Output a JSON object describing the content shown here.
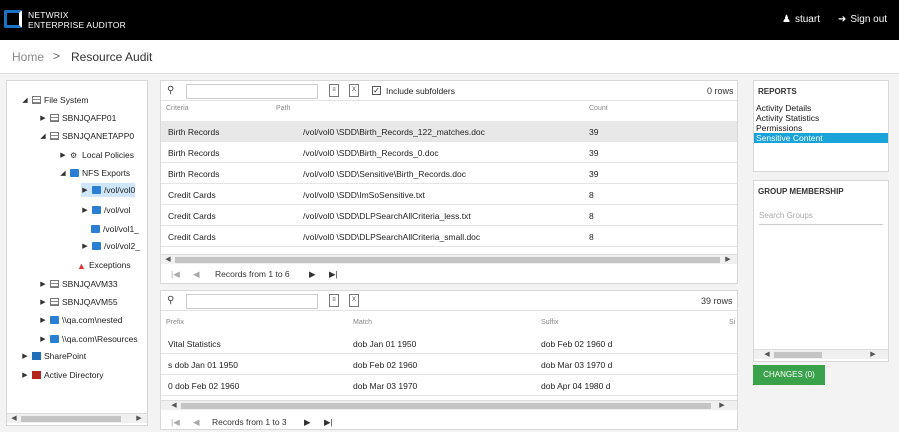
{
  "header": {
    "brand_line1": "NETWRIX",
    "brand_line2": "ENTERPRISE AUDITOR",
    "user_name": "stuart",
    "signout_label": "Sign out"
  },
  "breadcrumb": {
    "home": "Home",
    "separator": ">",
    "current": "Resource Audit"
  },
  "tree": {
    "nodes": [
      {
        "label": "File System",
        "icon": "file-system-icon"
      },
      {
        "label": "SBNJQAFP01",
        "icon": "server-icon"
      },
      {
        "label": "SBNJQANETAPP0",
        "icon": "server-icon"
      },
      {
        "label": "Local Policies",
        "icon": "policy-icon"
      },
      {
        "label": "NFS Exports",
        "icon": "folder-icon"
      },
      {
        "label": "/vol/vol0",
        "icon": "folder-icon"
      },
      {
        "label": "/vol/vol",
        "icon": "folder-lock-icon"
      },
      {
        "label": "/vol/vol1_",
        "icon": "folder-icon"
      },
      {
        "label": "/vol/vol2_",
        "icon": "folder-icon"
      },
      {
        "label": "Exceptions",
        "icon": "warning-icon"
      },
      {
        "label": "SBNJQAVM33",
        "icon": "server-icon"
      },
      {
        "label": "SBNJQAVM55",
        "icon": "server-icon"
      },
      {
        "label": "\\\\qa.com\\nested",
        "icon": "folder-icon"
      },
      {
        "label": "\\\\qa.com\\Resources",
        "icon": "folder-icon"
      },
      {
        "label": "SharePoint",
        "icon": "sharepoint-icon"
      },
      {
        "label": "Active Directory",
        "icon": "active-directory-icon"
      }
    ]
  },
  "grid1": {
    "include_subfolders_label": "Include subfolders",
    "include_subfolders_checked": true,
    "row_count": "0 rows",
    "columns": [
      "Criteria",
      "Path",
      "Count"
    ],
    "rows": [
      {
        "criteria": "Birth Records",
        "path": "/vol/vol0 \\SDD\\Birth_Records_122_matches.doc",
        "count": "39"
      },
      {
        "criteria": "Birth Records",
        "path": "/vol/vol0 \\SDD\\Birth_Records_0.doc",
        "count": "39"
      },
      {
        "criteria": "Birth Records",
        "path": "/vol/vol0 \\SDD\\Sensitive\\Birth_Records.doc",
        "count": "39"
      },
      {
        "criteria": "Credit Cards",
        "path": "/vol/vol0 \\SDD\\ImSoSensitive.txt",
        "count": "8"
      },
      {
        "criteria": "Credit Cards",
        "path": "/vol/vol0 \\SDD\\DLPSearchAllCriteria_less.txt",
        "count": "8"
      },
      {
        "criteria": "Credit Cards",
        "path": "/vol/vol0 \\SDD\\DLPSearchAllCriteria_small.doc",
        "count": "8"
      }
    ],
    "pager_text": "Records from 1 to 6"
  },
  "grid2": {
    "row_count": "39 rows",
    "columns": [
      "Prefix",
      "Match",
      "Suffix",
      "Si"
    ],
    "rows": [
      {
        "prefix": "Vital Statistics",
        "match": "dob Jan 01 1950",
        "suffix": "dob Feb 02 1960 d"
      },
      {
        "prefix": "s dob Jan 01 1950",
        "match": "dob Feb 02 1960",
        "suffix": "dob Mar 03 1970 d"
      },
      {
        "prefix": "0 dob Feb 02 1960",
        "match": "dob Mar 03 1970",
        "suffix": "dob Apr 04 1980 d"
      }
    ],
    "pager_text": "Records from 1 to 3"
  },
  "reports": {
    "title": "REPORTS",
    "items": [
      "Activity Details",
      "Activity Statistics",
      "Permissions",
      "Sensitive Content"
    ],
    "active_index": 3
  },
  "group_membership": {
    "title": "GROUP MEMBERSHIP",
    "search_placeholder": "Search Groups"
  },
  "changes_button": "CHANGES (0)",
  "colors": {
    "topbar": "#000000",
    "accent": "#1aa3d8",
    "changes": "#3aa24a"
  }
}
